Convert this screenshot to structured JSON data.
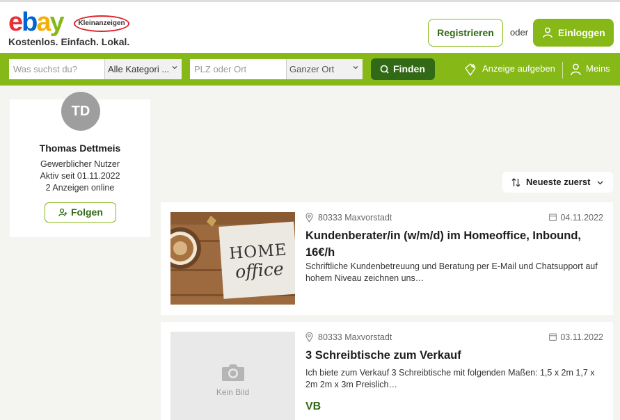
{
  "header": {
    "logo_main": [
      "e",
      "b",
      "a",
      "y"
    ],
    "logo_badge": "Kleinanzeigen",
    "tagline": "Kostenlos. Einfach. Lokal.",
    "register_label": "Registrieren",
    "or_label": "oder",
    "login_label": "Einloggen"
  },
  "search": {
    "query_placeholder": "Was suchst du?",
    "category_value": "Alle Kategori ...",
    "location_placeholder": "PLZ oder Ort",
    "radius_value": "Ganzer Ort",
    "find_label": "Finden",
    "post_ad_label": "Anzeige aufgeben",
    "account_label": "Meins"
  },
  "profile": {
    "initials": "TD",
    "name": "Thomas Dettmeis",
    "type": "Gewerblicher Nutzer",
    "active_since": "Aktiv seit 01.11.2022",
    "ads_online": "2 Anzeigen online",
    "follow_label": "Folgen"
  },
  "sort": {
    "label": "Neueste zuerst"
  },
  "ads": [
    {
      "location": "80333 Maxvorstadt",
      "date": "04.11.2022",
      "title": "Kundenberater/in (w/m/d) im Homeoffice, Inbound, 16€/h",
      "description": "Schriftliche Kundenbetreuung und Beratung per E-Mail und Chatsupport auf hohem Niveau zeichnen uns…",
      "image_text_line1": "HOME",
      "image_text_line2": "office"
    },
    {
      "location": "80333 Maxvorstadt",
      "date": "03.11.2022",
      "title": "3 Schreibtische zum Verkauf",
      "description": "Ich biete zum Verkauf 3 Schreibtische mit folgenden Maßen: 1,5 x 2m 1,7 x 2m 2m x 3m Preislich…",
      "no_image_label": "Kein Bild",
      "price": "VB"
    }
  ],
  "colors": {
    "brand_green": "#86b817",
    "dark_green": "#326916"
  },
  "icons": [
    "user-icon",
    "search-icon",
    "add-ad-icon",
    "chevron-down-icon",
    "follow-icon",
    "sort-icon",
    "location-pin-icon",
    "calendar-icon",
    "camera-icon"
  ]
}
